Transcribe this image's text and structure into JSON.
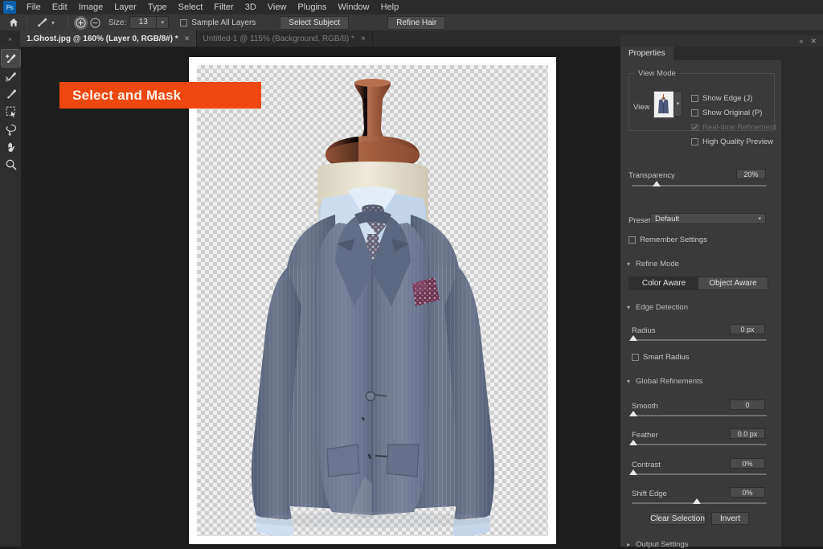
{
  "app": {
    "logo": "Ps",
    "menus": [
      "File",
      "Edit",
      "Image",
      "Layer",
      "Type",
      "Select",
      "Filter",
      "3D",
      "View",
      "Plugins",
      "Window",
      "Help"
    ]
  },
  "options_bar": {
    "home_icon": "home-icon",
    "brush_preset_icon": "brush-preset-icon",
    "add_icon": "plus-circle-icon",
    "subtract_icon": "minus-circle-icon",
    "size_label": "Size:",
    "size_value": "13",
    "sample_all_layers": "Sample All Layers",
    "select_subject": "Select Subject",
    "refine_hair": "Refine Hair"
  },
  "tabs": {
    "overflow_icon": "chevron-double-right-icon",
    "items": [
      {
        "label": "1.Ghost.jpg @ 160% (Layer 0, RGB/8#) *",
        "active": true,
        "close": "×"
      },
      {
        "label": "Untitled-1 @ 115% (Background, RGB/8) *",
        "active": false,
        "close": "×"
      }
    ]
  },
  "toolbar": {
    "tools": [
      {
        "name": "quick-selection-tool",
        "active": true
      },
      {
        "name": "refine-edge-brush-tool",
        "active": false
      },
      {
        "name": "brush-tool",
        "active": false
      },
      {
        "name": "object-selection-tool",
        "active": false
      },
      {
        "name": "lasso-tool",
        "active": false
      },
      {
        "name": "hand-tool",
        "active": false
      },
      {
        "name": "zoom-tool",
        "active": false
      }
    ]
  },
  "banner": {
    "text": "Select and Mask",
    "color": "#ef4710"
  },
  "canvas": {
    "document_name": "1.Ghost.jpg",
    "artwork": "mens-blue-suit-on-mannequin",
    "background": "transparent-checkerboard"
  },
  "properties_panel": {
    "collapse_icon": "collapse-panel-icon",
    "close_icon": "close-panel-icon",
    "tab_label": "Properties",
    "view_mode": {
      "title": "View Mode",
      "view_label": "View",
      "view_thumb": "onion-skin-preview",
      "dropdown_icon": "chevron-down-icon",
      "checkboxes": [
        {
          "label": "Show Edge (J)",
          "checked": false,
          "disabled": false
        },
        {
          "label": "Show Original (P)",
          "checked": false,
          "disabled": false
        },
        {
          "label": "Real-time Refinement",
          "checked": true,
          "disabled": true
        },
        {
          "label": "High Quality Preview",
          "checked": false,
          "disabled": false
        }
      ],
      "transparency_label": "Transparency",
      "transparency_value": "20%",
      "transparency_pct": 20
    },
    "preset": {
      "label": "Preset",
      "value": "Default",
      "dropdown_icon": "chevron-down-icon",
      "remember_settings": "Remember Settings",
      "remember_checked": false
    },
    "refine_mode": {
      "title": "Refine Mode",
      "chevron": "chevron-down-icon",
      "options": [
        {
          "label": "Color Aware",
          "selected": true
        },
        {
          "label": "Object Aware",
          "selected": false
        }
      ]
    },
    "edge_detection": {
      "title": "Edge Detection",
      "chevron": "chevron-down-icon",
      "radius_label": "Radius",
      "radius_value": "0 px",
      "radius_pct": 0,
      "smart_radius": "Smart Radius",
      "smart_radius_checked": false
    },
    "global_refinements": {
      "title": "Global Refinements",
      "chevron": "chevron-down-icon",
      "sliders": [
        {
          "label": "Smooth",
          "value": "0",
          "pct": 0
        },
        {
          "label": "Feather",
          "value": "0.0 px",
          "pct": 0
        },
        {
          "label": "Contrast",
          "value": "0%",
          "pct": 0
        },
        {
          "label": "Shift Edge",
          "value": "0%",
          "pct": 50
        }
      ]
    },
    "actions": {
      "clear_selection": "Clear Selection",
      "invert": "Invert"
    },
    "output_settings": {
      "title": "Output Settings",
      "chevron": "chevron-right-icon"
    }
  }
}
